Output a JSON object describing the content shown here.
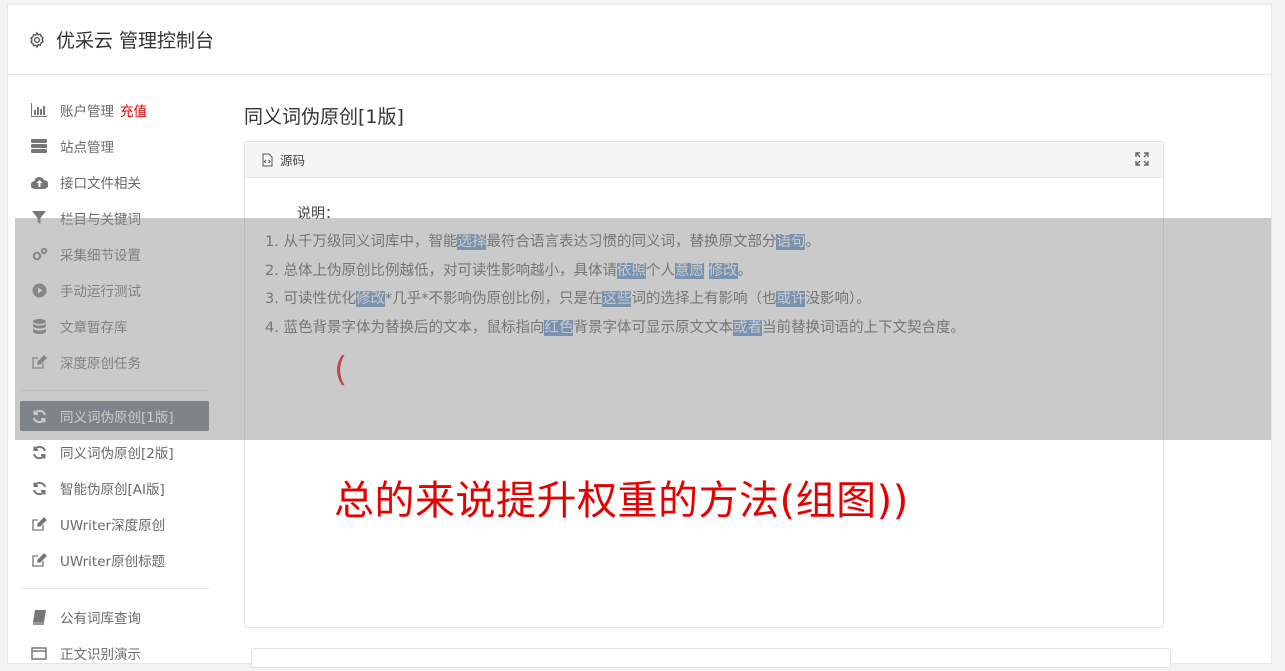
{
  "header": {
    "icon": "gear-icon",
    "title": "优采云 管理控制台"
  },
  "sidebar": {
    "group1": [
      {
        "label": "账户管理",
        "icon": "bar-chart-icon",
        "badge": "充值"
      },
      {
        "label": "站点管理",
        "icon": "server-icon"
      },
      {
        "label": "接口文件相关",
        "icon": "cloud-upload-icon"
      },
      {
        "label": "栏目与关键词",
        "icon": "filter-icon"
      },
      {
        "label": "采集细节设置",
        "icon": "cogs-icon"
      },
      {
        "label": "手动运行测试",
        "icon": "play-circle-icon"
      },
      {
        "label": "文章暂存库",
        "icon": "database-icon"
      },
      {
        "label": "深度原创任务",
        "icon": "edit-icon"
      }
    ],
    "group2": [
      {
        "label": "同义词伪原创[1版]",
        "icon": "refresh-icon",
        "active": true
      },
      {
        "label": "同义词伪原创[2版]",
        "icon": "refresh-icon"
      },
      {
        "label": "智能伪原创[AI版]",
        "icon": "refresh-icon"
      },
      {
        "label": "UWriter深度原创",
        "icon": "edit-icon"
      },
      {
        "label": "UWriter原创标题",
        "icon": "edit-icon"
      }
    ],
    "group3": [
      {
        "label": "公有词库查询",
        "icon": "book-icon"
      },
      {
        "label": "正文识别演示",
        "icon": "window-icon"
      }
    ]
  },
  "main": {
    "page_title": "同义词伪原创[1版]",
    "panel": {
      "header_icon": "code-file-icon",
      "header_label": "源码",
      "expand_icon": "expand-icon",
      "explain_label": "说明：",
      "rules": [
        [
          {
            "t": "1. 从千万级同义词库中，智能"
          },
          {
            "t": "选择",
            "h": true
          },
          {
            "t": "最符合语言表达习惯的同义词，替换原文部分"
          },
          {
            "t": "语句",
            "h": true
          },
          {
            "t": "。"
          }
        ],
        [
          {
            "t": "2. 总体上伪原创比例越低，对可读性影响越小，具体请"
          },
          {
            "t": "依照",
            "h": true
          },
          {
            "t": "个人"
          },
          {
            "t": "意愿",
            "h": true
          },
          {
            "t": " "
          },
          {
            "t": "修改",
            "h": true
          },
          {
            "t": "。"
          }
        ],
        [
          {
            "t": "3. 可读性优化"
          },
          {
            "t": "修改",
            "h": true
          },
          {
            "t": "*几乎*不影响伪原创比例，只是在"
          },
          {
            "t": "这些",
            "h": true
          },
          {
            "t": "词的选择上有影响（也"
          },
          {
            "t": "或许",
            "h": true
          },
          {
            "t": "没影响）。"
          }
        ],
        [
          {
            "t": "4. 蓝色背景字体为替换后的文本，鼠标指向"
          },
          {
            "t": "红色",
            "h": true
          },
          {
            "t": "背景字体可显示原文文本"
          },
          {
            "t": "或者",
            "h": true
          },
          {
            "t": "当前替换词语的上下文契合度。"
          }
        ]
      ],
      "paren_text": "(",
      "big_text": "总的来说提升权重的方法(组图))"
    }
  },
  "colors": {
    "active_bg": "#66737e",
    "highlight_bg": "#5b8fc9",
    "red": "#e60000"
  }
}
